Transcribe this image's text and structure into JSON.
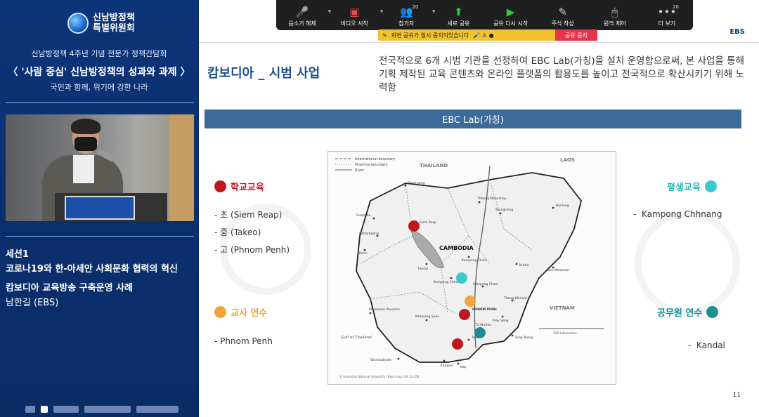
{
  "left_panel": {
    "logo": {
      "line1": "신남방정책",
      "line2": "특별위원회"
    },
    "event": {
      "line1": "신남방정책 4주년 기념 전문가 정책간담회",
      "line2": "〈 '사람 중심' 신남방정책의 성과와 과제 〉",
      "line3": "국민과 함께, 위기에 강한 나라"
    },
    "session": {
      "label": "세션1",
      "title": "코로나19와 한-아세안 사회문화 협력의 혁신",
      "talk": "캄보디아 교육방송 구축운영 사례"
    },
    "speaker": "남한길 (EBS)"
  },
  "toolbar": {
    "items": [
      {
        "label": "음소거 해제",
        "icon": "mic-muted-icon"
      },
      {
        "label": "비디오 시작",
        "icon": "video-off-icon"
      },
      {
        "label": "참가자",
        "icon": "participants-icon",
        "count": "20"
      },
      {
        "label": "새로 공유",
        "icon": "share-icon"
      },
      {
        "label": "공유 다시 시작",
        "icon": "resume-icon"
      },
      {
        "label": "주석 작성",
        "icon": "annotate-icon"
      },
      {
        "label": "원격 제어",
        "icon": "remote-control-icon"
      },
      {
        "label": "더 보기",
        "icon": "more-icon",
        "count": "20"
      }
    ],
    "share_status": "화면 공유가 일시 중지되었습니다",
    "stop_share": "공유 중지"
  },
  "slide": {
    "brand": "EBS",
    "title": "캄보디아 _ 시범 사업",
    "description": "전국적으로 6개 시범 기관을 선정하여 EBC Lab(가칭)을 설치 운영함으로써, 본 사업을 통해 기획 제작된 교육 콘텐츠와 온라인 플랫폼의 활용도를 높이고 전국적으로 확산시키기 위해 노력함",
    "banner": "EBC Lab(가칭)",
    "categories": [
      {
        "name": "학교교육",
        "color": "#c0161e",
        "items": [
          "초 (Siem Reap)",
          "중 (Takeo)",
          "고 (Phnom Penh)"
        ]
      },
      {
        "name": "교사 연수",
        "color": "#f2a33a",
        "items": [
          "Phnom Penh"
        ]
      },
      {
        "name": "평생교육",
        "color": "#3cc8cc",
        "items": [
          "Kampong Chhnang"
        ]
      },
      {
        "name": "공무원 연수",
        "color": "#1a8f96",
        "items": [
          "Kandal"
        ]
      }
    ],
    "map": {
      "legend": [
        "International boundary",
        "Province boundary",
        "River"
      ],
      "country": "CAMBODIA",
      "neighbors": [
        "THAILAND",
        "LAOS",
        "VIETNAM"
      ],
      "sea": "Gulf of Thailand",
      "places": [
        "Samraong",
        "Siem Reap",
        "Sisophon",
        "Battambang",
        "Pailin",
        "Thbeng Meanchey",
        "Stungtreng",
        "Banlung",
        "Kampong Thom",
        "Kratie",
        "Sen Monorom",
        "Pursat",
        "Kampong Chhnang",
        "Kampong Cham",
        "Tbong Khmum",
        "PHNOM PENH",
        "Ta Khmau",
        "Prey Veng",
        "Svay Rieng",
        "Kampong Speu",
        "Takeo",
        "Khemarak Phoumin",
        "Sihanoukville",
        "Kampot",
        "Kep"
      ],
      "credit": "© Australian National University / Base map CAP 12-256",
      "scale": "150 kilometres"
    },
    "page": "11"
  }
}
